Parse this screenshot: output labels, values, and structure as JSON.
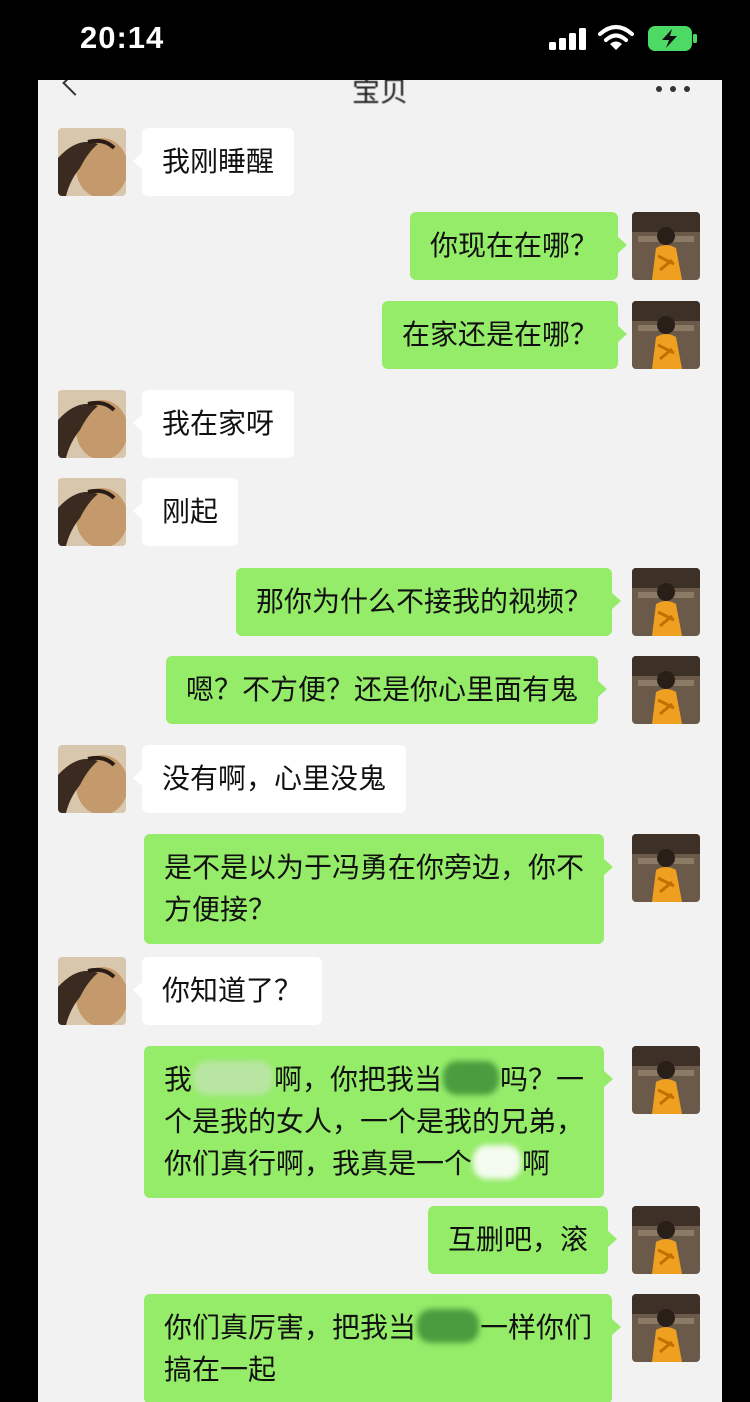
{
  "status_bar": {
    "time": "20:14"
  },
  "header": {
    "title": "宝贝"
  },
  "messages": [
    {
      "side": "left",
      "lines": [
        "我刚睡醒"
      ]
    },
    {
      "side": "right",
      "lines": [
        "你现在在哪？"
      ]
    },
    {
      "side": "right",
      "lines": [
        "在家还是在哪？"
      ]
    },
    {
      "side": "left",
      "lines": [
        "我在家呀"
      ]
    },
    {
      "side": "left",
      "lines": [
        "刚起"
      ]
    },
    {
      "side": "right",
      "lines": [
        "那你为什么不接我的视频？"
      ]
    },
    {
      "side": "right",
      "lines": [
        "嗯？不方便？还是你心里面有鬼"
      ]
    },
    {
      "side": "left",
      "lines": [
        "没有啊，心里没鬼"
      ]
    },
    {
      "side": "right",
      "lines": [
        "是不是以为于冯勇在你旁边，你不",
        "方便接？"
      ]
    },
    {
      "side": "left",
      "lines": [
        "你知道了？"
      ]
    },
    {
      "side": "right",
      "segments": [
        [
          "我",
          "啊，你把我当",
          "吗？一"
        ],
        [
          "个是我的女人，一个是我的兄弟，"
        ],
        [
          "你们真行啊，我真是一个",
          "啊"
        ]
      ]
    },
    {
      "side": "right",
      "lines": [
        "互删吧，滚"
      ]
    },
    {
      "side": "right",
      "segments": [
        [
          "你们真厉害，把我当",
          "一样你们"
        ],
        [
          "搞在一起"
        ]
      ]
    }
  ]
}
